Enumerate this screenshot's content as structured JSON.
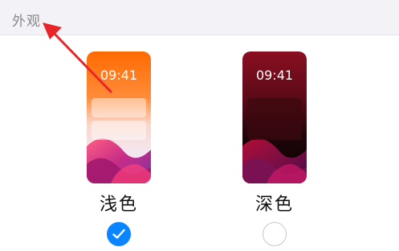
{
  "section": {
    "title": "外观"
  },
  "options": [
    {
      "label": "浅色",
      "time": "09:41",
      "selected": true
    },
    {
      "label": "深色",
      "time": "09:41",
      "selected": false
    }
  ],
  "colors": {
    "accent": "#0a84ff",
    "light_wallpaper_top": "#ff6a00",
    "dark_wallpaper_top": "#8a0f20",
    "annotation_arrow": "#e8262a"
  },
  "icons": {
    "selected_indicator": "checkmark-icon",
    "annotation": "arrow-icon"
  }
}
